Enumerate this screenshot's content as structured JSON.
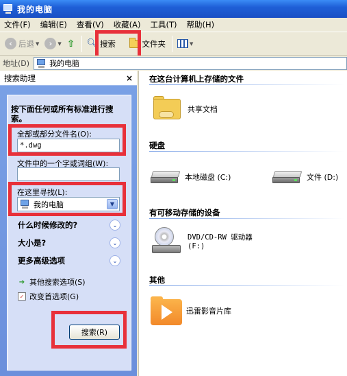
{
  "window": {
    "title": "我的电脑"
  },
  "menu": [
    "文件(F)",
    "编辑(E)",
    "查看(V)",
    "收藏(A)",
    "工具(T)",
    "帮助(H)"
  ],
  "toolbar": {
    "back": "后退",
    "search": "搜索",
    "folders": "文件夹"
  },
  "address": {
    "label": "地址(D)",
    "value": "我的电脑"
  },
  "search_pane": {
    "header": "搜索助理",
    "close": "×",
    "intro": "按下面任何或所有标准进行搜索。",
    "filename_label": "全部或部分文件名(O):",
    "filename_value": "*.dwg",
    "word_label": "文件中的一个字或词组(W):",
    "word_value": "",
    "lookin_label": "在这里寻找(L):",
    "lookin_value": "我的电脑",
    "when_modified": "什么时候修改的?",
    "size": "大小是?",
    "advanced": "更多高级选项",
    "other_options": "其他搜索选项(S)",
    "change_prefs": "改变首选项(G)",
    "search_button": "搜索(R)"
  },
  "content": {
    "sec_stored": "在这台计算机上存储的文件",
    "shared_docs": "共享文档",
    "sec_hdd": "硬盘",
    "local_disk": "本地磁盘 (C:)",
    "docs_disk": "文件 (D:)",
    "sec_removable": "有可移动存储的设备",
    "dvd_name": "DVD/CD-RW 驱动器",
    "dvd_letter": "(F:)",
    "sec_other": "其他",
    "media_lib": "迅雷影音片库"
  },
  "colors": {
    "highlight": "#e8303a",
    "titlebar": "#1f5fd7",
    "pane": "#6b8fdc"
  }
}
